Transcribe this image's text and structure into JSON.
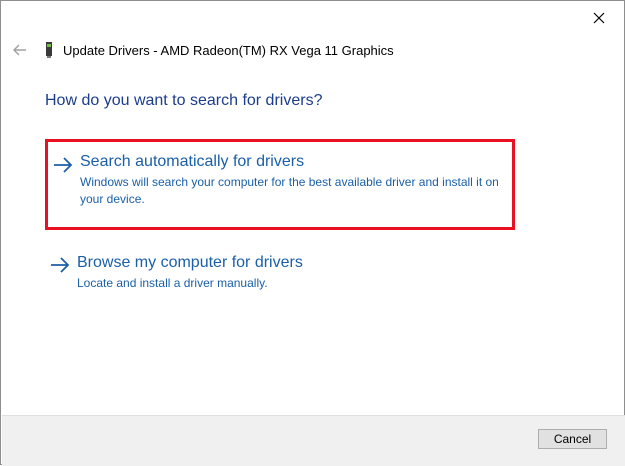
{
  "window": {
    "title": "Update Drivers - AMD Radeon(TM) RX Vega 11 Graphics"
  },
  "heading": "How do you want to search for drivers?",
  "options": [
    {
      "title": "Search automatically for drivers",
      "description": "Windows will search your computer for the best available driver and install it on your device.",
      "highlighted": true
    },
    {
      "title": "Browse my computer for drivers",
      "description": "Locate and install a driver manually.",
      "highlighted": false
    }
  ],
  "footer": {
    "cancel_label": "Cancel"
  },
  "icons": {
    "close": "close-icon",
    "back": "back-arrow-icon",
    "device": "graphics-card-icon",
    "option_arrow": "arrow-right-icon"
  },
  "colors": {
    "link": "#1b5fa8",
    "heading": "#1c3c8c",
    "highlight_border": "#e81123",
    "footer_bg": "#f0f0f0"
  }
}
